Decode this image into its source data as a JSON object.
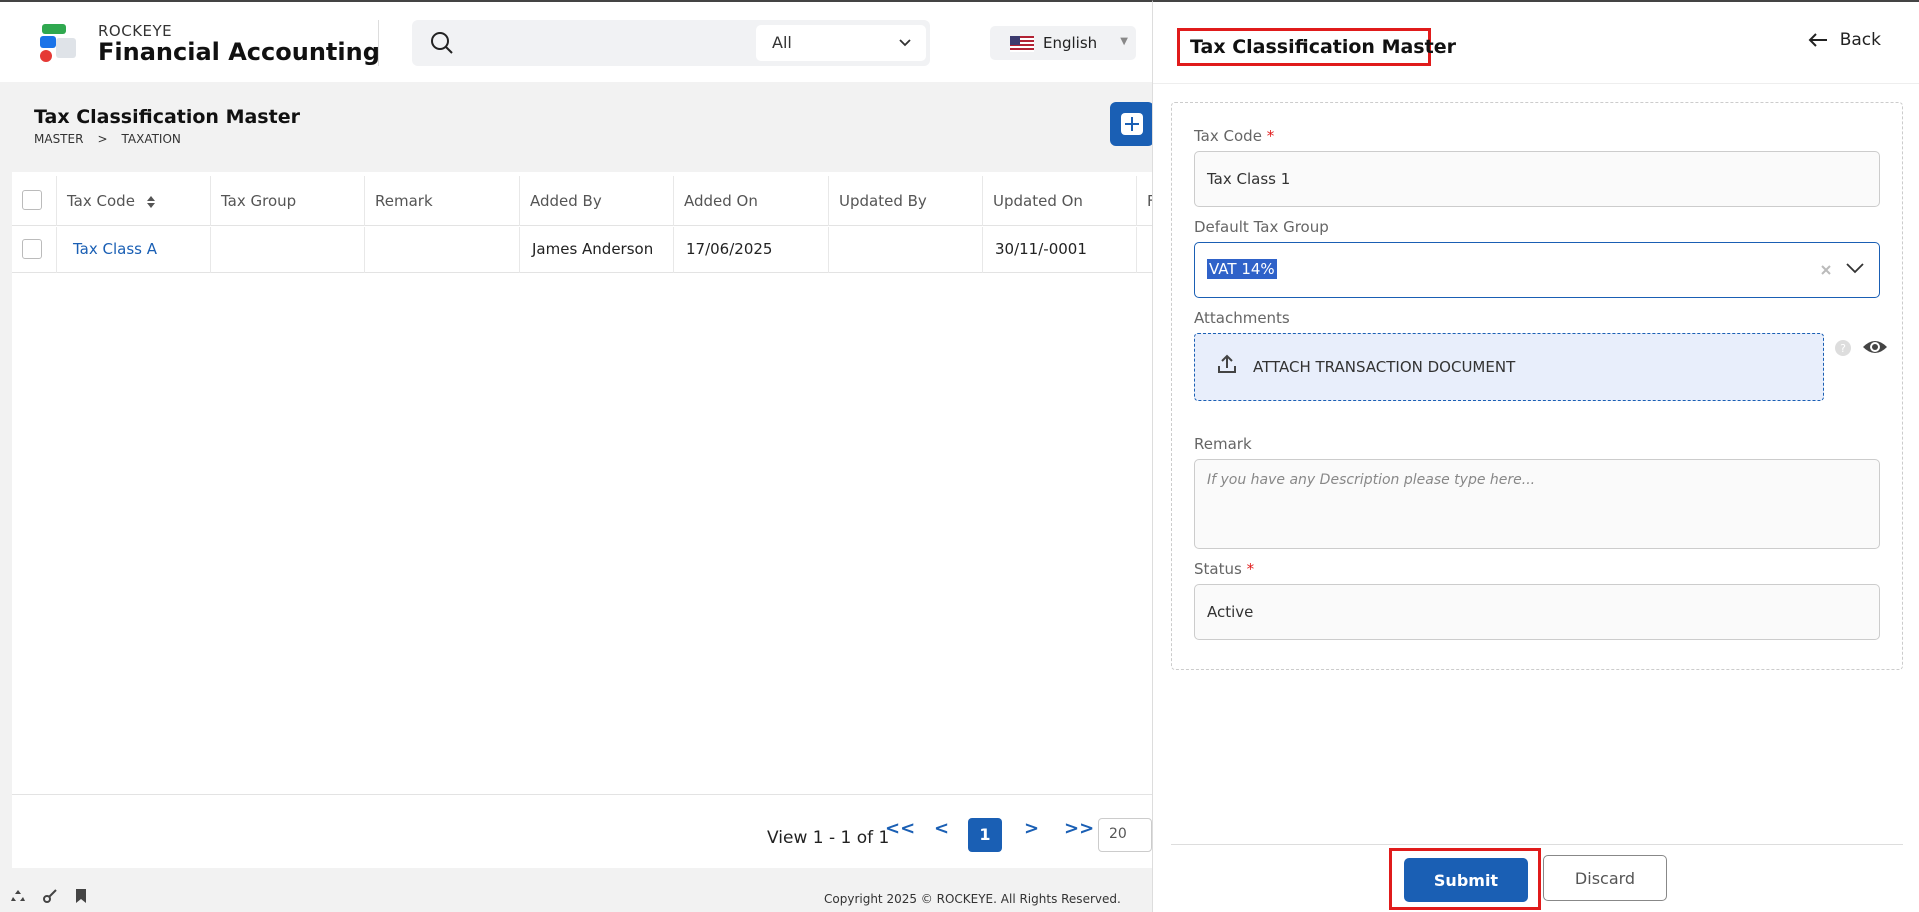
{
  "header": {
    "brand_small": "ROCKEYE",
    "brand_big": "Financial Accounting",
    "search_placeholder": "",
    "scope_value": "All",
    "language": "English"
  },
  "page": {
    "title": "Tax Classification Master",
    "breadcrumb": [
      "MASTER",
      ">",
      "TAXATION"
    ]
  },
  "table": {
    "columns": [
      "Tax Code",
      "Tax Group",
      "Remark",
      "Added By",
      "Added On",
      "Updated By",
      "Updated On",
      "F"
    ],
    "rows": [
      {
        "tax_code": "Tax Class A",
        "tax_group": "",
        "remark": "",
        "added_by": "James Anderson",
        "added_on": "17/06/2025",
        "updated_by": "",
        "updated_on": "30/11/-0001"
      }
    ],
    "pager_text": "View 1 - 1 of 1",
    "first": "<<",
    "prev": "<",
    "current_page": "1",
    "next": ">",
    "last": ">>",
    "page_size": "20"
  },
  "footer": {
    "copyright": "Copyright 2025 © ROCKEYE. All Rights Reserved."
  },
  "panel": {
    "title": "Tax Classification Master",
    "back_label": "Back",
    "tax_code_label": "Tax Code",
    "tax_code_value": "Tax Class 1",
    "default_tax_group_label": "Default Tax Group",
    "default_tax_group_value": "VAT 14%",
    "attachments_label": "Attachments",
    "attach_button": "ATTACH TRANSACTION DOCUMENT",
    "remark_label": "Remark",
    "remark_placeholder": "If you have any Description please type here...",
    "status_label": "Status",
    "status_value": "Active",
    "required_mark": "*",
    "submit_label": "Submit",
    "discard_label": "Discard"
  },
  "colors": {
    "primary": "#1a5fb4",
    "highlight_red": "#e01b1b",
    "selection": "#2f62c9"
  }
}
